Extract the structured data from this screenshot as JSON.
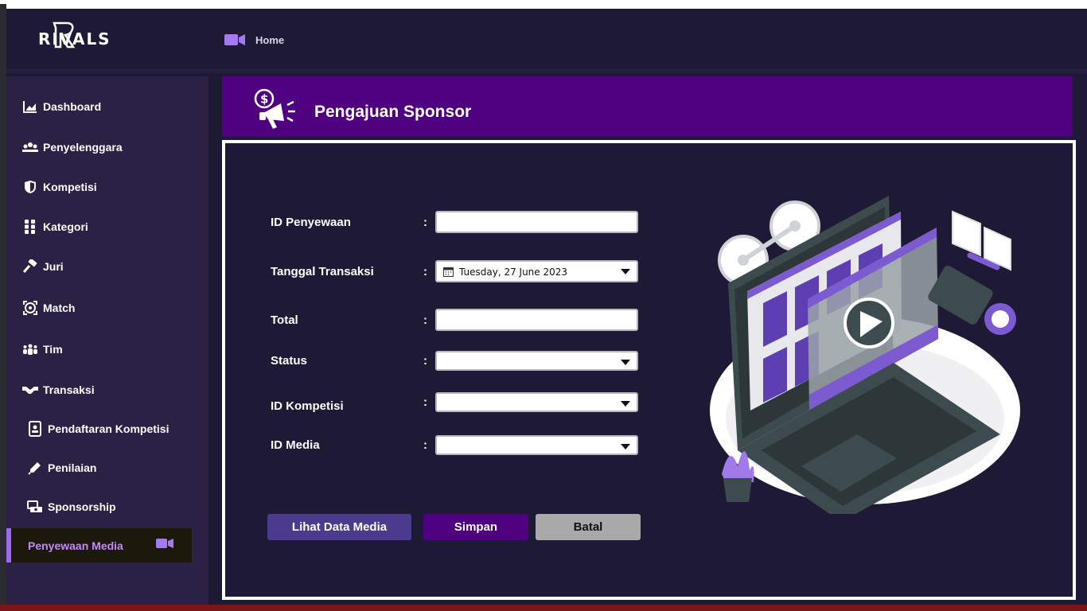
{
  "app": {
    "logo_text": "RIVALS"
  },
  "header": {
    "breadcrumb": "Home",
    "breadcrumb_icon": "video-camera-icon"
  },
  "sidebar": {
    "items": [
      {
        "label": "Dashboard",
        "icon": "chart-icon"
      },
      {
        "label": "Penyelenggara",
        "icon": "organizer-icon"
      },
      {
        "label": "Kompetisi",
        "icon": "shield-icon"
      },
      {
        "label": "Kategori",
        "icon": "grid-icon"
      },
      {
        "label": "Juri",
        "icon": "gavel-icon"
      },
      {
        "label": "Match",
        "icon": "target-icon"
      },
      {
        "label": "Tim",
        "icon": "team-icon"
      },
      {
        "label": "Transaksi",
        "icon": "handshake-icon"
      },
      {
        "label": "Pendaftaran Kompetisi",
        "icon": "id-badge-icon"
      },
      {
        "label": "Penilaian",
        "icon": "pen-icon"
      },
      {
        "label": "Sponsorship",
        "icon": "sponsorship-icon"
      }
    ],
    "active": {
      "label": "Penyewaan Media",
      "icon": "video-camera-icon"
    }
  },
  "page": {
    "title": "Pengajuan Sponsor",
    "title_icon": "megaphone-dollar-icon"
  },
  "form": {
    "colon": ":",
    "id_penyewaan": {
      "label": "ID Penyewaan",
      "value": ""
    },
    "tanggal_transaksi": {
      "label": "Tanggal Transaksi",
      "value": "Tuesday, 27 June 2023"
    },
    "total": {
      "label": "Total",
      "value": ""
    },
    "status": {
      "label": "Status",
      "value": ""
    },
    "id_kompetisi": {
      "label": "ID Kompetisi",
      "value": ""
    },
    "id_media": {
      "label": "ID Media",
      "value": ""
    }
  },
  "buttons": {
    "lihat": "Lihat Data Media",
    "simpan": "Simpan",
    "batal": "Batal"
  },
  "colors": {
    "banner": "#4f0080",
    "sidebar": "#2a2145",
    "background": "#1e1a36",
    "accent": "#9b6cf0",
    "btn_lihat": "#4a3b8f",
    "btn_simpan": "#4f0080",
    "btn_batal": "#a9a9a9"
  }
}
